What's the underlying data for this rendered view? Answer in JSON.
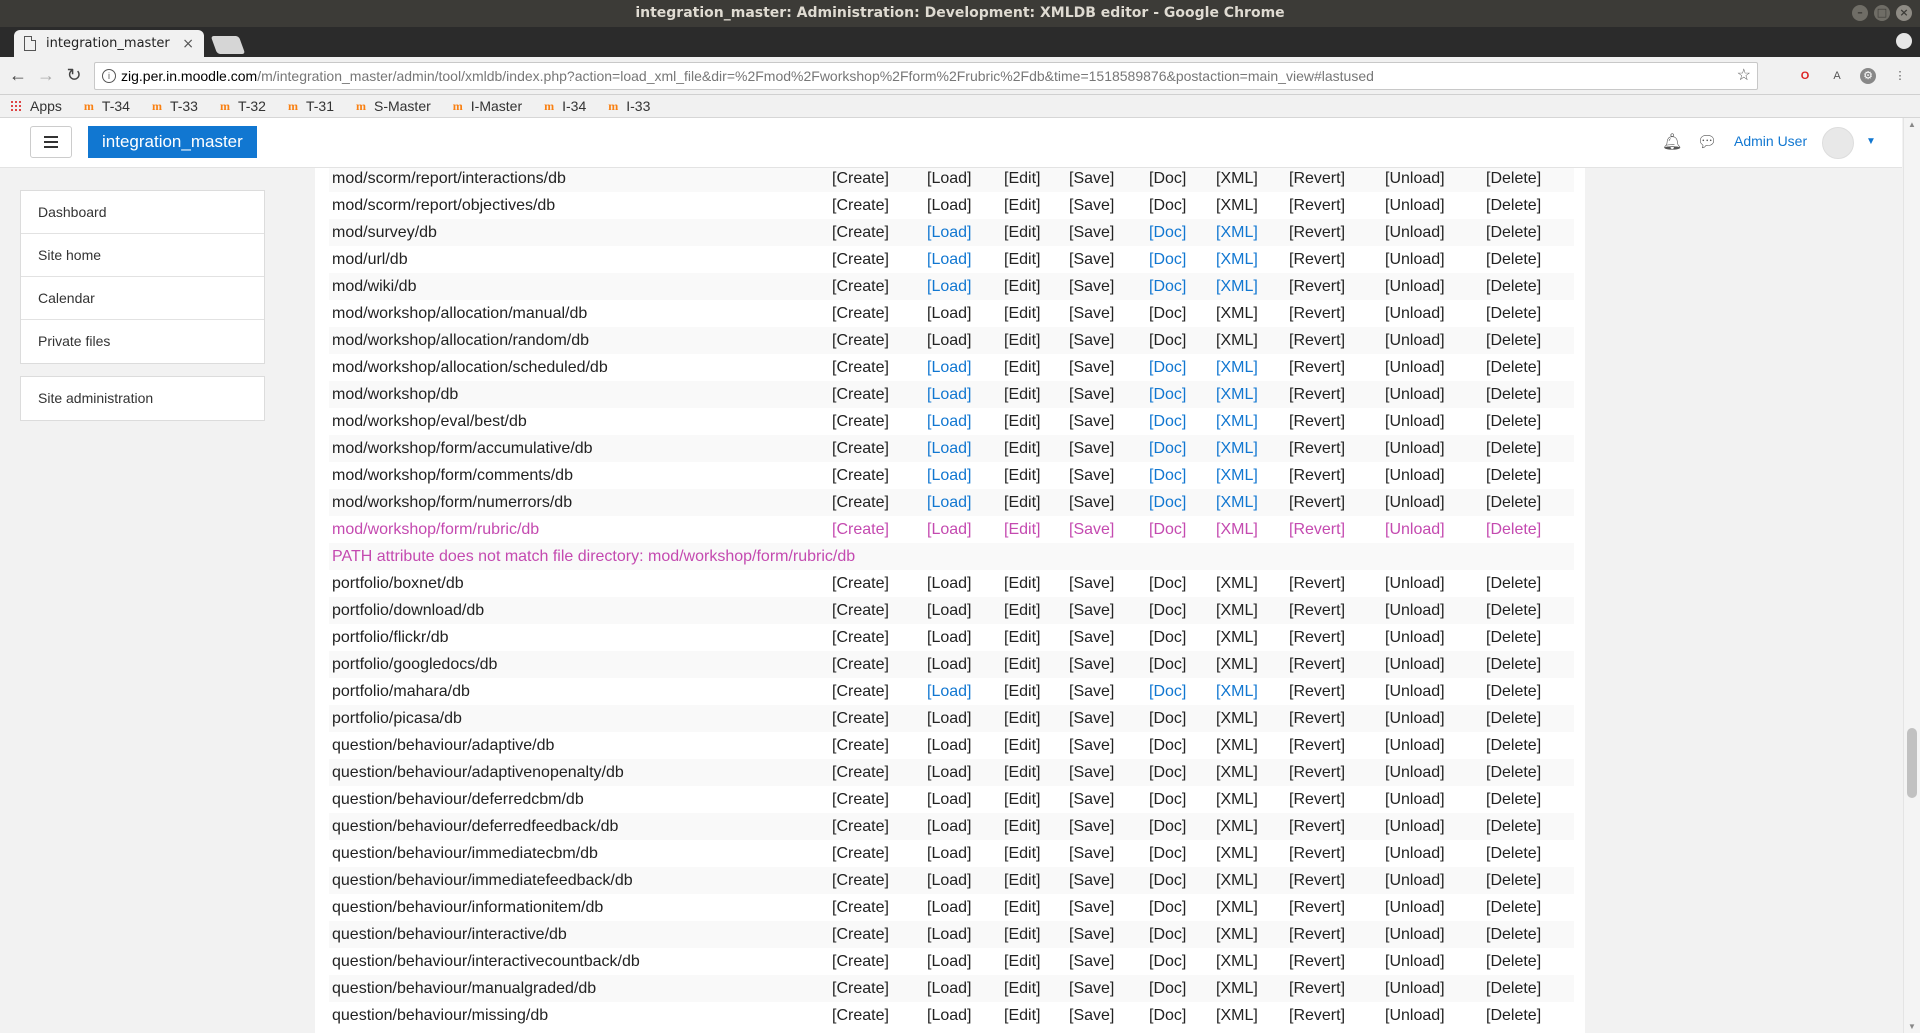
{
  "window": {
    "title": "integration_master: Administration: Development: XMLDB editor - Google Chrome"
  },
  "browser": {
    "tab_title": "integration_master",
    "url_host": "zig.per.in.moodle.com",
    "url_rest": "/m/integration_master/admin/tool/xmldb/index.php?action=load_xml_file&dir=%2Fmod%2Fworkshop%2Fform%2Frubric%2Fdb&time=1518589876&postaction=main_view#lastused",
    "bookmarks": [
      "Apps",
      "T-34",
      "T-33",
      "T-32",
      "T-31",
      "S-Master",
      "I-Master",
      "I-34",
      "I-33"
    ]
  },
  "navbar": {
    "brand": "integration_master",
    "user_name": "Admin User"
  },
  "drawer": {
    "items": [
      "Dashboard",
      "Site home",
      "Calendar",
      "Private files"
    ],
    "admin": "Site administration"
  },
  "colors": {
    "link": "#1177d1",
    "changed": "#c44ab0"
  },
  "actions": [
    "[Create]",
    "[Load]",
    "[Edit]",
    "[Save]",
    "[Doc]",
    "[XML]",
    "[Revert]",
    "[Unload]",
    "[Delete]"
  ],
  "rows": [
    {
      "path": "mod/scorm/report/interactions/db",
      "links": []
    },
    {
      "path": "mod/scorm/report/objectives/db",
      "links": []
    },
    {
      "path": "mod/survey/db",
      "links": [
        1,
        4,
        5
      ]
    },
    {
      "path": "mod/url/db",
      "links": [
        1,
        4,
        5
      ]
    },
    {
      "path": "mod/wiki/db",
      "links": [
        1,
        4,
        5
      ]
    },
    {
      "path": "mod/workshop/allocation/manual/db",
      "links": []
    },
    {
      "path": "mod/workshop/allocation/random/db",
      "links": []
    },
    {
      "path": "mod/workshop/allocation/scheduled/db",
      "links": [
        1,
        4,
        5
      ]
    },
    {
      "path": "mod/workshop/db",
      "links": [
        1,
        4,
        5
      ]
    },
    {
      "path": "mod/workshop/eval/best/db",
      "links": [
        1,
        4,
        5
      ]
    },
    {
      "path": "mod/workshop/form/accumulative/db",
      "links": [
        1,
        4,
        5
      ]
    },
    {
      "path": "mod/workshop/form/comments/db",
      "links": [
        1,
        4,
        5
      ]
    },
    {
      "path": "mod/workshop/form/numerrors/db",
      "links": [
        1,
        4,
        5
      ]
    },
    {
      "path": "mod/workshop/form/rubric/db",
      "links": [
        1,
        4,
        5
      ],
      "changed": true
    },
    {
      "message": "PATH attribute does not match file directory: mod/workshop/form/rubric/db"
    },
    {
      "path": "portfolio/boxnet/db",
      "links": []
    },
    {
      "path": "portfolio/download/db",
      "links": []
    },
    {
      "path": "portfolio/flickr/db",
      "links": []
    },
    {
      "path": "portfolio/googledocs/db",
      "links": []
    },
    {
      "path": "portfolio/mahara/db",
      "links": [
        1,
        4,
        5
      ]
    },
    {
      "path": "portfolio/picasa/db",
      "links": []
    },
    {
      "path": "question/behaviour/adaptive/db",
      "links": []
    },
    {
      "path": "question/behaviour/adaptivenopenalty/db",
      "links": []
    },
    {
      "path": "question/behaviour/deferredcbm/db",
      "links": []
    },
    {
      "path": "question/behaviour/deferredfeedback/db",
      "links": []
    },
    {
      "path": "question/behaviour/immediatecbm/db",
      "links": []
    },
    {
      "path": "question/behaviour/immediatefeedback/db",
      "links": []
    },
    {
      "path": "question/behaviour/informationitem/db",
      "links": []
    },
    {
      "path": "question/behaviour/interactive/db",
      "links": []
    },
    {
      "path": "question/behaviour/interactivecountback/db",
      "links": []
    },
    {
      "path": "question/behaviour/manualgraded/db",
      "links": []
    },
    {
      "path": "question/behaviour/missing/db",
      "links": []
    }
  ]
}
